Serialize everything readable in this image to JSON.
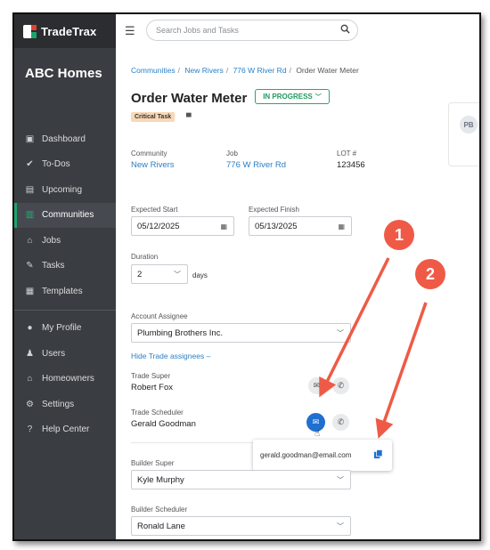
{
  "app": {
    "name": "TradeTrax",
    "company": "ABC Homes",
    "brand_colors": {
      "sidebar": "#3a3d42",
      "accent": "#1aa56b",
      "link": "#2a7fc6"
    }
  },
  "sidebar": {
    "items": [
      {
        "label": "Dashboard",
        "icon": "dashboard-icon",
        "glyph": "▣"
      },
      {
        "label": "To-Dos",
        "icon": "check-circle-icon",
        "glyph": "✔"
      },
      {
        "label": "Upcoming",
        "icon": "clipboard-icon",
        "glyph": "▤"
      },
      {
        "label": "Communities",
        "icon": "building-icon",
        "glyph": "▥"
      },
      {
        "label": "Jobs",
        "icon": "home-icon",
        "glyph": "⌂"
      },
      {
        "label": "Tasks",
        "icon": "wrench-icon",
        "glyph": "✎"
      },
      {
        "label": "Templates",
        "icon": "map-icon",
        "glyph": "▦"
      }
    ],
    "items2": [
      {
        "label": "My Profile",
        "icon": "user-circle-icon",
        "glyph": "●"
      },
      {
        "label": "Users",
        "icon": "users-icon",
        "glyph": "♟"
      },
      {
        "label": "Homeowners",
        "icon": "house-icon",
        "glyph": "⌂"
      },
      {
        "label": "Settings",
        "icon": "gear-icon",
        "glyph": "⚙"
      },
      {
        "label": "Help Center",
        "icon": "help-icon",
        "glyph": "?"
      }
    ]
  },
  "search": {
    "placeholder": "Search Jobs and Tasks"
  },
  "breadcrumb": {
    "b1": "Communities",
    "b2": "New Rivers",
    "b3": "776 W River Rd",
    "b4": "Order Water Meter"
  },
  "task": {
    "title": "Order Water Meter",
    "status": "IN PROGRESS",
    "tag": "Critical Task",
    "community_label": "Community",
    "community": "New Rivers",
    "job_label": "Job",
    "job": "776 W River Rd",
    "lot_label": "LOT #",
    "lot": "123456",
    "expected_start_label": "Expected Start",
    "expected_start": "05/12/2025",
    "expected_finish_label": "Expected Finish",
    "expected_finish": "05/13/2025",
    "duration_label": "Duration",
    "duration": "2",
    "duration_unit": "days",
    "account_assignee_label": "Account Assignee",
    "account_assignee": "Plumbing Brothers Inc.",
    "hide_trade_link": "Hide Trade assignees",
    "trade_super_label": "Trade Super",
    "trade_super": "Robert Fox",
    "trade_scheduler_label": "Trade Scheduler",
    "trade_scheduler": "Gerald Goodman",
    "builder_super_label": "Builder Super",
    "builder_super": "Kyle Murphy",
    "builder_scheduler_label": "Builder Scheduler",
    "builder_scheduler": "Ronald Lane",
    "email_popover": "gerald.goodman@email.com"
  },
  "side_card": {
    "initials": "PB"
  },
  "annotations": {
    "one": "1",
    "two": "2"
  }
}
